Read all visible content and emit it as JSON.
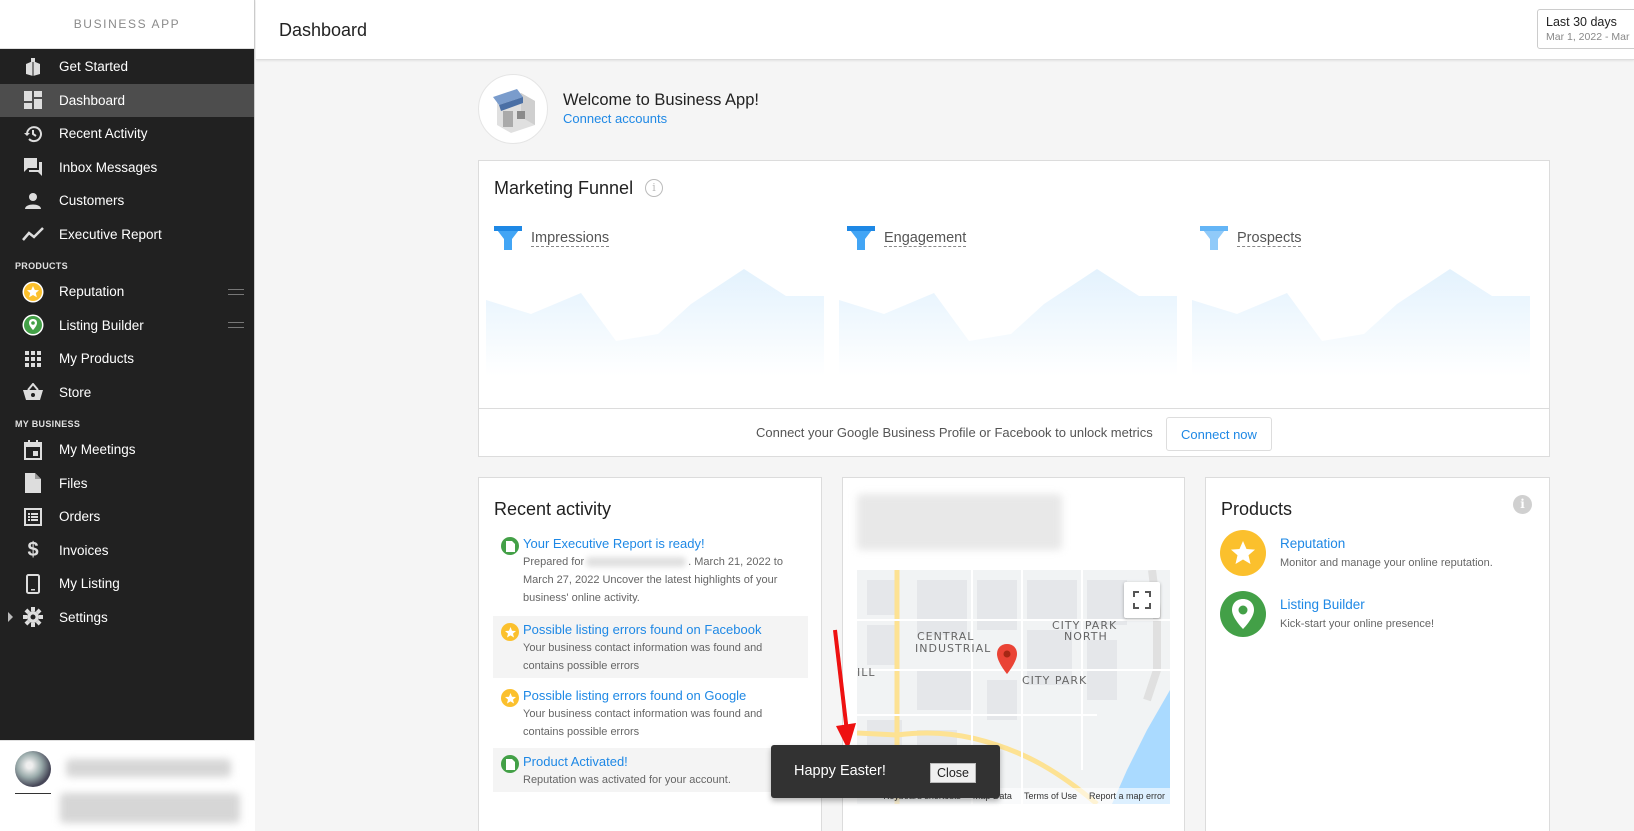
{
  "brand": "BUSINESS APP",
  "header": {
    "title": "Dashboard",
    "date_label": "Last 30 days",
    "date_range": "Mar 1, 2022 - Mar"
  },
  "sidebar": {
    "items": [
      {
        "label": "Get Started",
        "icon": "book-icon"
      },
      {
        "label": "Dashboard",
        "icon": "dashboard-icon",
        "active": true
      },
      {
        "label": "Recent Activity",
        "icon": "history-icon"
      },
      {
        "label": "Inbox Messages",
        "icon": "chat-icon"
      },
      {
        "label": "Customers",
        "icon": "person-icon"
      },
      {
        "label": "Executive Report",
        "icon": "trend-icon"
      }
    ],
    "products_section": "PRODUCTS",
    "products": [
      {
        "label": "Reputation",
        "icon": "star-badge-icon"
      },
      {
        "label": "Listing Builder",
        "icon": "pin-badge-icon"
      },
      {
        "label": "My Products",
        "icon": "grid-icon"
      },
      {
        "label": "Store",
        "icon": "basket-icon"
      }
    ],
    "business_section": "MY BUSINESS",
    "business": [
      {
        "label": "My Meetings",
        "icon": "calendar-icon"
      },
      {
        "label": "Files",
        "icon": "file-icon"
      },
      {
        "label": "Orders",
        "icon": "list-icon"
      },
      {
        "label": "Invoices",
        "icon": "dollar-icon"
      },
      {
        "label": "My Listing",
        "icon": "phone-icon"
      },
      {
        "label": "Settings",
        "icon": "gear-icon"
      }
    ]
  },
  "welcome": {
    "title": "Welcome to Business App!",
    "link": "Connect accounts"
  },
  "funnel": {
    "title": "Marketing Funnel",
    "columns": [
      "Impressions",
      "Engagement",
      "Prospects"
    ],
    "message": "Connect your Google Business Profile or Facebook to unlock metrics",
    "button": "Connect now"
  },
  "activity": {
    "title": "Recent activity",
    "items": [
      {
        "title": "Your Executive Report is ready!",
        "desc_a": "Prepared for",
        "desc_b": ". March 21, 2022 to March 27, 2022 Uncover the latest highlights of your business' online activity.",
        "color": "green"
      },
      {
        "title": "Possible listing errors found on Facebook",
        "desc": "Your business contact information was found and contains possible errors",
        "color": "yellow"
      },
      {
        "title": "Possible listing errors found on Google",
        "desc": "Your business contact information was found and contains possible errors",
        "color": "yellow"
      },
      {
        "title": "Product Activated!",
        "desc": "Reputation was activated for your account.",
        "color": "green"
      }
    ]
  },
  "map": {
    "labels": [
      "CENTRAL",
      "INDUSTRIAL",
      "CITY PARK",
      "NORTH",
      "CITY PARK",
      "ILL"
    ],
    "footer": [
      "Keyboard shortcuts",
      "Map Data",
      "Terms of Use",
      "Report a map error"
    ]
  },
  "products": {
    "title": "Products",
    "items": [
      {
        "name": "Reputation",
        "desc": "Monitor and manage your online reputation.",
        "color": "#fbc02d"
      },
      {
        "name": "Listing Builder",
        "desc": "Kick-start your online presence!",
        "color": "#43a047"
      }
    ]
  },
  "toast": {
    "message": "Happy Easter!",
    "button": "Close"
  },
  "colors": {
    "accent": "#1e88e5",
    "sidebar": "#212121",
    "active": "#4d4d4d",
    "funnel_blue": "#42a5f5"
  }
}
